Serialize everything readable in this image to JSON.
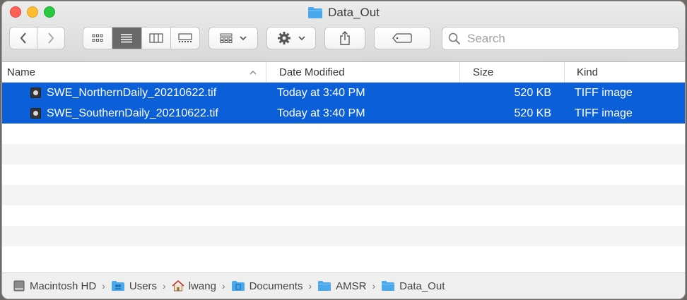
{
  "window": {
    "title": "Data_Out"
  },
  "toolbar": {
    "search_placeholder": "Search"
  },
  "columns": {
    "name": "Name",
    "date_modified": "Date Modified",
    "size": "Size",
    "kind": "Kind"
  },
  "files": [
    {
      "name": "SWE_NorthernDaily_20210622.tif",
      "date": "Today at 3:40 PM",
      "size": "520 KB",
      "kind": "TIFF image"
    },
    {
      "name": "SWE_SouthernDaily_20210622.tif",
      "date": "Today at 3:40 PM",
      "size": "520 KB",
      "kind": "TIFF image"
    }
  ],
  "breadcrumb": [
    "Macintosh HD",
    "Users",
    "lwang",
    "Documents",
    "AMSR",
    "Data_Out"
  ],
  "colors": {
    "selection": "#0b5fd8",
    "folder": "#4aa8ec"
  }
}
